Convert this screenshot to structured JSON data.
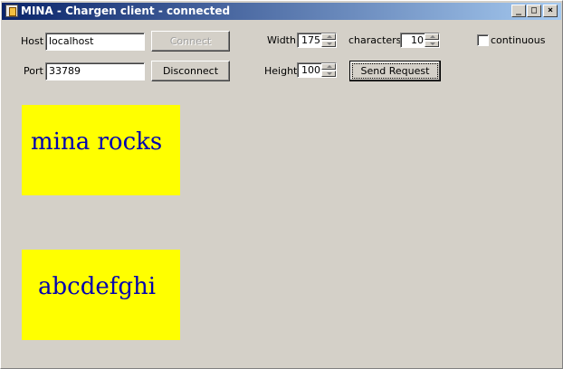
{
  "window": {
    "title": "MINA - Chargen client - connected",
    "controls": {
      "minimize": "_",
      "maximize": "□",
      "close": "×"
    }
  },
  "connection": {
    "host_label": "Host",
    "host_value": "localhost",
    "port_label": "Port",
    "port_value": "33789",
    "connect_label": "Connect",
    "disconnect_label": "Disconnect"
  },
  "request": {
    "width_label": "Width",
    "width_value": "175",
    "height_label": "Height",
    "height_value": "100",
    "characters_label": "characters",
    "characters_value": "10",
    "continuous_label": "continuous",
    "continuous_checked": false,
    "send_label": "Send Request"
  },
  "output": {
    "panels": [
      {
        "text": "mina rocks"
      },
      {
        "text": "abcdefghi"
      }
    ]
  },
  "colors": {
    "panel_background": "#ffff00",
    "panel_text": "#0000b0",
    "titlebar_start": "#0a246a",
    "titlebar_end": "#a6caf0"
  }
}
